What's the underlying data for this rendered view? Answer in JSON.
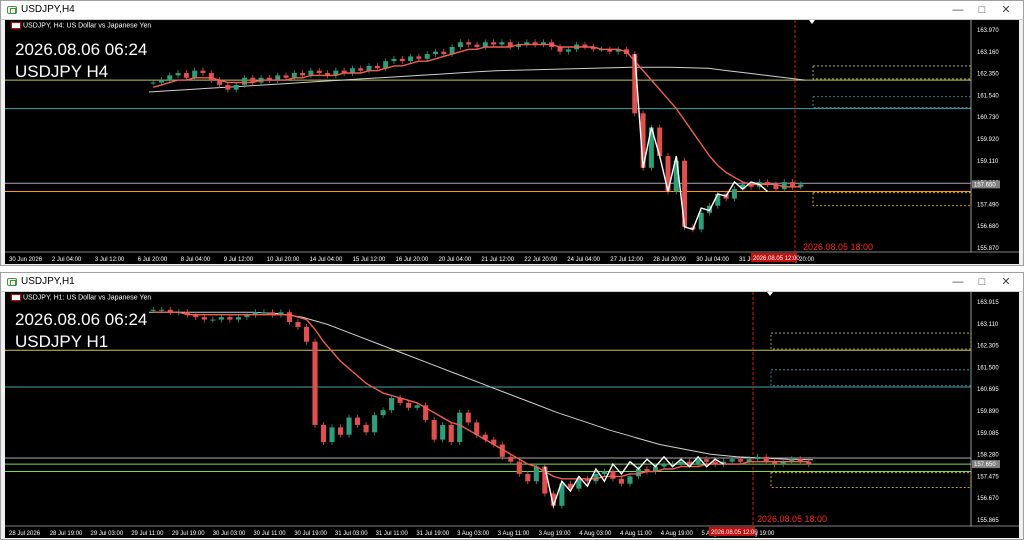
{
  "windows": [
    {
      "id": "h4",
      "title": "USDJPY,H4",
      "header_text": "USDJPY, H4:  US Dollar vs Japanese Yen",
      "overlay_datetime": "2026.08.06 06:24",
      "overlay_symbol": "USDJPY H4",
      "vline_label": "2026.08.05 18:00",
      "current_price_badge": "157.650",
      "current_time_badge": "2026.08.05 12:00",
      "price_axis": [
        "163.970",
        "163.160",
        "162.350",
        "161.540",
        "160.730",
        "159.920",
        "159.110",
        "158.300",
        "157.490",
        "156.680",
        "155.870"
      ],
      "time_axis": [
        "30 Jun 2026",
        "2 Jul 04:00",
        "3 Jul 12:00",
        "6 Jul 20:00",
        "8 Jul 04:00",
        "9 Jul 12:00",
        "10 Jul 20:00",
        "14 Jul 04:00",
        "15 Jul 12:00",
        "16 Jul 20:00",
        "20 Jul 04:00",
        "21 Jul 12:00",
        "22 Jul 20:00",
        "24 Jul 04:00",
        "27 Jul 12:00",
        "28 Jul 20:00",
        "30 Jul 04:00",
        "31 Jul 12:00",
        "3 Aug 20:00"
      ],
      "y_range": [
        155.2,
        164.4
      ],
      "closes": [
        162.1,
        162.2,
        162.4,
        162.5,
        162.3,
        162.6,
        162.5,
        162.2,
        162.0,
        161.8,
        162.0,
        162.3,
        162.1,
        162.3,
        162.2,
        162.4,
        162.3,
        162.5,
        162.4,
        162.6,
        162.5,
        162.4,
        162.6,
        162.5,
        162.7,
        162.6,
        162.8,
        162.7,
        163.0,
        163.1,
        163.0,
        163.2,
        163.1,
        163.3,
        163.4,
        163.3,
        163.6,
        163.8,
        163.7,
        163.6,
        163.8,
        163.7,
        163.8,
        163.6,
        163.7,
        163.8,
        163.7,
        163.8,
        163.6,
        163.4,
        163.5,
        163.7,
        163.6,
        163.5,
        163.5,
        163.4,
        163.5,
        163.3,
        160.8,
        158.5,
        160.2,
        159.0,
        157.5,
        158.8,
        156.0,
        155.9,
        156.6,
        156.9,
        157.4,
        157.2,
        157.6,
        157.8,
        157.7,
        157.9,
        157.8,
        157.6,
        157.9,
        157.7,
        157.8
      ],
      "ema_red": [
        161.9,
        162.0,
        162.1,
        162.2,
        162.2,
        162.3,
        162.3,
        162.3,
        162.2,
        162.1,
        162.1,
        162.1,
        162.1,
        162.2,
        162.2,
        162.2,
        162.2,
        162.3,
        162.3,
        162.4,
        162.4,
        162.4,
        162.4,
        162.5,
        162.5,
        162.5,
        162.6,
        162.6,
        162.7,
        162.8,
        162.8,
        162.9,
        163.0,
        163.0,
        163.1,
        163.2,
        163.3,
        163.4,
        163.5,
        163.5,
        163.6,
        163.6,
        163.6,
        163.6,
        163.7,
        163.7,
        163.7,
        163.7,
        163.7,
        163.6,
        163.6,
        163.6,
        163.6,
        163.6,
        163.5,
        163.5,
        163.5,
        163.4,
        163.0,
        162.6,
        162.2,
        161.8,
        161.4,
        161.0,
        160.5,
        160.0,
        159.5,
        159.0,
        158.6,
        158.3,
        158.1,
        157.9,
        157.8,
        157.8,
        157.8,
        157.8,
        157.7,
        157.7,
        157.7
      ],
      "ma_white": [
        161.7,
        161.75,
        161.8,
        161.85,
        161.9,
        161.95,
        162.0,
        162.05,
        162.1,
        162.15,
        162.2,
        162.25,
        162.3,
        162.35,
        162.4,
        162.45,
        162.5,
        162.55,
        162.6,
        162.62,
        162.64,
        162.66,
        162.68,
        162.7,
        162.72,
        162.74,
        162.74,
        162.74,
        162.72,
        162.7,
        162.6,
        162.5,
        162.4,
        162.3,
        162.2
      ],
      "zigzag": [
        [
          58,
          163.3
        ],
        [
          59,
          158.5
        ],
        [
          60,
          160.2
        ],
        [
          61,
          159.0
        ],
        [
          62,
          157.5
        ],
        [
          63,
          159.0
        ],
        [
          64,
          156.0
        ],
        [
          65,
          155.9
        ],
        [
          66,
          156.8
        ],
        [
          67,
          156.7
        ],
        [
          68,
          157.4
        ],
        [
          69,
          157.3
        ],
        [
          70,
          157.9
        ],
        [
          71,
          157.6
        ],
        [
          72,
          157.9
        ],
        [
          73,
          157.8
        ],
        [
          74,
          157.5
        ]
      ],
      "hlines": [
        {
          "price": 162.2,
          "color": "#c8c850"
        },
        {
          "price": 161.0,
          "color": "#4aa0b0"
        },
        {
          "price": 157.5,
          "color": "#ff9900"
        },
        {
          "price": 157.85,
          "color": "#aaaaaa"
        }
      ],
      "zones": [
        {
          "p1": 162.8,
          "p2": 162.25,
          "color": "#c8c850"
        },
        {
          "p1": 161.5,
          "p2": 161.05,
          "color": "#4aa0b0"
        },
        {
          "p1": 157.45,
          "p2": 156.9,
          "color": "#ffcc00"
        }
      ]
    },
    {
      "id": "h1",
      "title": "USDJPY,H1",
      "header_text": "USDJPY, H1:  US Dollar vs Japanese Yen",
      "overlay_datetime": "2026.08.06 06:24",
      "overlay_symbol": "USDJPY H1",
      "vline_label": "2026.08.05 18:00",
      "current_price_badge": "157.650",
      "current_time_badge": "2026.08.05 12:00",
      "price_axis": [
        "163.915",
        "163.110",
        "162.305",
        "161.500",
        "160.695",
        "159.890",
        "159.085",
        "158.280",
        "157.475",
        "156.670",
        "155.865"
      ],
      "time_axis": [
        "28 Jul 2026",
        "28 Jul 19:00",
        "29 Jul 03:00",
        "29 Jul 11:00",
        "29 Jul 19:00",
        "30 Jul 03:00",
        "30 Jul 11:00",
        "30 Jul 19:00",
        "31 Jul 03:00",
        "31 Jul 11:00",
        "31 Jul 19:00",
        "3 Aug 03:00",
        "3 Aug 11:00",
        "3 Aug 19:00",
        "4 Aug 03:00",
        "4 Aug 11:00",
        "4 Aug 19:00",
        "5 Aug 03:00",
        "5 Aug 19:00"
      ],
      "y_range": [
        155.4,
        164.3
      ],
      "closes": [
        163.9,
        163.9,
        163.8,
        163.8,
        163.7,
        163.6,
        163.5,
        163.5,
        163.6,
        163.5,
        163.6,
        163.7,
        163.8,
        163.8,
        163.7,
        163.8,
        163.4,
        163.2,
        162.6,
        159.2,
        158.5,
        159.1,
        158.8,
        159.5,
        159.2,
        158.9,
        159.6,
        159.8,
        160.3,
        160.1,
        159.9,
        160.0,
        159.4,
        158.6,
        159.2,
        158.5,
        159.7,
        159.3,
        158.8,
        158.6,
        158.4,
        157.9,
        157.7,
        157.2,
        156.9,
        157.5,
        156.4,
        155.9,
        156.8,
        156.6,
        157.0,
        156.9,
        157.2,
        157.3,
        157.0,
        156.8,
        157.1,
        157.4,
        157.3,
        157.5,
        157.6,
        157.6,
        157.7,
        157.6,
        157.8,
        157.7,
        157.6,
        157.7,
        157.8,
        157.7,
        157.8,
        157.9,
        157.7,
        157.6,
        157.7,
        157.8,
        157.7,
        157.6
      ],
      "ema_red": [
        163.8,
        163.8,
        163.8,
        163.8,
        163.7,
        163.7,
        163.7,
        163.7,
        163.7,
        163.7,
        163.7,
        163.7,
        163.7,
        163.7,
        163.7,
        163.7,
        163.7,
        163.6,
        163.5,
        163.1,
        162.6,
        162.2,
        161.8,
        161.5,
        161.2,
        160.9,
        160.7,
        160.5,
        160.4,
        160.3,
        160.2,
        160.1,
        159.9,
        159.7,
        159.5,
        159.3,
        159.2,
        159.0,
        158.8,
        158.6,
        158.4,
        158.2,
        158.0,
        157.8,
        157.6,
        157.5,
        157.3,
        157.1,
        157.0,
        157.0,
        157.0,
        157.0,
        157.0,
        157.1,
        157.1,
        157.1,
        157.2,
        157.2,
        157.3,
        157.3,
        157.4,
        157.4,
        157.5,
        157.5,
        157.5,
        157.6,
        157.6,
        157.6,
        157.6,
        157.6,
        157.7,
        157.7,
        157.7,
        157.7,
        157.7,
        157.7,
        157.7,
        157.7
      ],
      "ma_white": [
        163.8,
        163.8,
        163.8,
        163.8,
        163.8,
        163.75,
        163.6,
        163.3,
        162.9,
        162.5,
        162.1,
        161.7,
        161.3,
        160.9,
        160.5,
        160.1,
        159.7,
        159.35,
        159.0,
        158.7,
        158.4,
        158.2,
        158.0,
        157.9,
        157.85,
        157.8,
        157.78
      ],
      "zigzag": [
        [
          46,
          157.5
        ],
        [
          47,
          155.9
        ],
        [
          48,
          156.9
        ],
        [
          49,
          156.5
        ],
        [
          50,
          157.1
        ],
        [
          51,
          156.7
        ],
        [
          52,
          157.4
        ],
        [
          53,
          156.9
        ],
        [
          54,
          157.6
        ],
        [
          55,
          157.2
        ],
        [
          56,
          157.7
        ],
        [
          57,
          157.4
        ],
        [
          58,
          157.8
        ],
        [
          59,
          157.5
        ],
        [
          60,
          157.9
        ],
        [
          61,
          157.5
        ],
        [
          62,
          157.8
        ],
        [
          63,
          157.5
        ],
        [
          64,
          157.9
        ],
        [
          65,
          157.5
        ],
        [
          66,
          157.8
        ],
        [
          67,
          157.6
        ]
      ],
      "hlines": [
        {
          "price": 162.25,
          "color": "#c8c850"
        },
        {
          "price": 160.75,
          "color": "#4aa0b0"
        },
        {
          "price": 157.85,
          "color": "#aaaaaa"
        },
        {
          "price": 157.6,
          "color": "#7ddc4a"
        },
        {
          "price": 157.3,
          "color": "#7ddc4a"
        }
      ],
      "zones": [
        {
          "p1": 162.95,
          "p2": 162.3,
          "color": "#c8c850"
        },
        {
          "p1": 161.45,
          "p2": 160.8,
          "color": "#4aa0b0"
        },
        {
          "p1": 157.25,
          "p2": 156.65,
          "color": "#ffcc00"
        }
      ]
    }
  ],
  "colors": {
    "bull": "#2e9e7a",
    "bear": "#e05050",
    "ema": "#f06050",
    "ma": "#d0d0d0",
    "zigzag": "#ffffff",
    "vline": "#ff2020",
    "background": "#000000",
    "grid_text": "#ffffff"
  },
  "icons": {
    "window_icon": "chart-window-icon",
    "minimize": "minimize-icon",
    "maximize": "maximize-icon",
    "close": "close-icon"
  }
}
